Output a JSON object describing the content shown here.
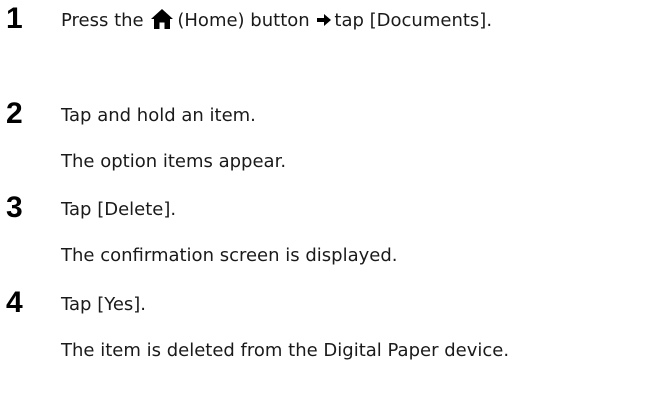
{
  "steps": [
    {
      "number": "1",
      "line1": {
        "part1": "Press the",
        "part2": "(Home) button",
        "part3": "tap [Documents]."
      }
    },
    {
      "number": "2",
      "line1": "Tap and hold an item.",
      "line2": "The option items appear."
    },
    {
      "number": "3",
      "line1": "Tap [Delete].",
      "line2": "The confirmation screen is displayed."
    },
    {
      "number": "4",
      "line1": "Tap [Yes].",
      "line2": "The item is deleted from the Digital Paper device."
    }
  ],
  "icons": {
    "home": "home-icon",
    "arrow": "right-arrow-icon"
  },
  "colors": {
    "text": "#1a1a1a",
    "number": "#000000"
  }
}
